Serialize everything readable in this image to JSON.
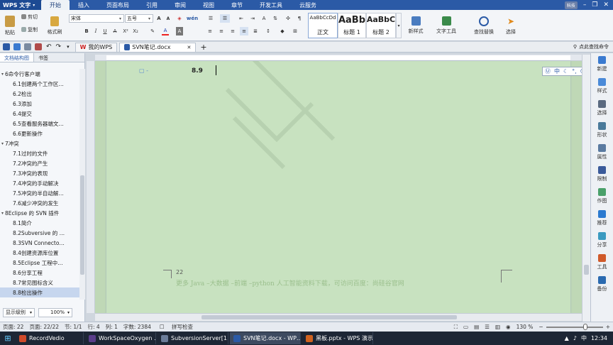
{
  "app": {
    "logo": "WPS 文字",
    "user_badge": "科技"
  },
  "menu_tabs": [
    "开始",
    "插入",
    "页面布局",
    "引用",
    "审阅",
    "视图",
    "章节",
    "开发工具",
    "云服务"
  ],
  "ribbon": {
    "paste": "粘贴",
    "cut": "剪切",
    "copy": "复制",
    "format_painter": "格式刷",
    "font_name": "宋体",
    "font_size": "五号",
    "styles": [
      {
        "preview": "AaBbCcDd",
        "label": "正文"
      },
      {
        "preview": "AaBb",
        "label": "标题 1"
      },
      {
        "preview": "AaBbC",
        "label": "标题 2"
      }
    ],
    "new_style": "新样式",
    "text_tools": "文字工具",
    "find_replace": "查找替换",
    "select": "选择"
  },
  "quick": {
    "wps_tab": "我的WPS",
    "doc_tab": "SVN笔记.docx",
    "search": "点此查找命令"
  },
  "pane": {
    "tab_nav": "文档结构图",
    "tab_bookmark": "书签",
    "level_select": "显示级别",
    "zoom_select": "100%"
  },
  "outline": [
    {
      "level": 0,
      "text": "6命令行客户端"
    },
    {
      "level": 1,
      "text": "6.1创建两个工作区…"
    },
    {
      "level": 1,
      "text": "6.2检出"
    },
    {
      "level": 1,
      "text": "6.3添加"
    },
    {
      "level": 1,
      "text": "6.4提交"
    },
    {
      "level": 1,
      "text": "6.5查看服务器端文…"
    },
    {
      "level": 1,
      "text": "6.6更新操作"
    },
    {
      "level": 0,
      "text": "7冲突"
    },
    {
      "level": 1,
      "text": "7.1过时的文件"
    },
    {
      "level": 1,
      "text": "7.2冲突的产生"
    },
    {
      "level": 1,
      "text": "7.3冲突的表现"
    },
    {
      "level": 1,
      "text": "7.4冲突的手动解决"
    },
    {
      "level": 1,
      "text": "7.5冲突的半自动解…"
    },
    {
      "level": 1,
      "text": "7.6减少冲突的发生"
    },
    {
      "level": 0,
      "text": "8Eclipse 的 SVN 插件"
    },
    {
      "level": 1,
      "text": "8.1简介"
    },
    {
      "level": 1,
      "text": "8.2Subversive 的 …"
    },
    {
      "level": 1,
      "text": "8.3SVN Connecto…"
    },
    {
      "level": 1,
      "text": "8.4创建资源库位置"
    },
    {
      "level": 1,
      "text": "8.5Eclipse 工程中…"
    },
    {
      "level": 1,
      "text": "8.6分享工程"
    },
    {
      "level": 1,
      "text": "8.7常见图标含义"
    },
    {
      "level": 1,
      "text": "8.8检出操作",
      "selected": true
    }
  ],
  "document": {
    "heading": "8.9",
    "page_number": "22",
    "footer": "更多 Java –大数据 –前端 –python 人工智能资料下载，可访问百度：尚硅谷官网"
  },
  "rightbar": [
    "新建",
    "样式",
    "选择",
    "形状",
    "属性",
    "限制",
    "作图",
    "推荐",
    "分享",
    "工具",
    "备份"
  ],
  "status": {
    "page": "页面: 22",
    "pages": "页面: 22/22",
    "section": "节: 1/1",
    "row": "行: 4",
    "col": "列: 1",
    "chars": "字数: 2384",
    "spell": "拼写检查",
    "zoom": "130 %"
  },
  "taskbar": [
    {
      "label": "RecordVedio",
      "color": "#d04a2a"
    },
    {
      "label": "WorkSpaceOxygen …",
      "color": "#5a3d8a"
    },
    {
      "label": "SubversionServer[1…",
      "color": "#6b7c99"
    },
    {
      "label": "SVN笔记.docx - WP…",
      "color": "#2b5aa6",
      "active": true
    },
    {
      "label": "黑板.pptx - WPS 演示",
      "color": "#d0621f"
    }
  ],
  "clock": {
    "time": "12:34",
    "lang": "中"
  }
}
